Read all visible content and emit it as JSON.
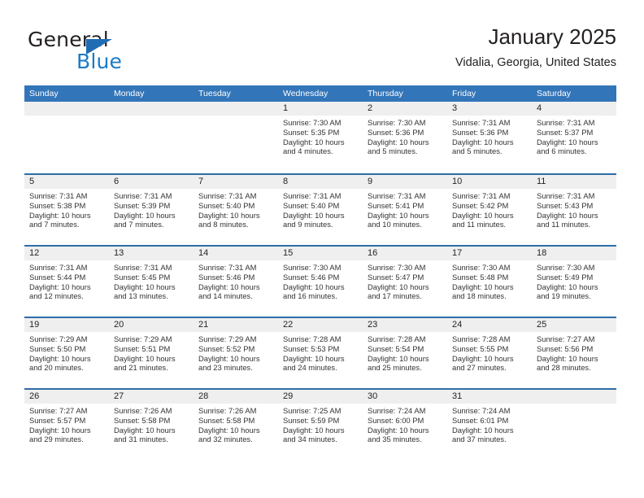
{
  "brand": {
    "name_part1": "General",
    "name_part2": "Blue",
    "accent_color": "#1b7ac4",
    "triangle_color": "#1f6cb4"
  },
  "header": {
    "title": "January 2025",
    "location": "Vidalia, Georgia, United States"
  },
  "theme": {
    "header_row_bg": "#3375b9",
    "week_divider": "#2d6da7",
    "daynum_bg": "#efefef",
    "text_color": "#231f20"
  },
  "weekdays": [
    "Sunday",
    "Monday",
    "Tuesday",
    "Wednesday",
    "Thursday",
    "Friday",
    "Saturday"
  ],
  "weeks": [
    [
      {
        "day": "",
        "sunrise": "",
        "sunset": "",
        "daylight": ""
      },
      {
        "day": "",
        "sunrise": "",
        "sunset": "",
        "daylight": ""
      },
      {
        "day": "",
        "sunrise": "",
        "sunset": "",
        "daylight": ""
      },
      {
        "day": "1",
        "sunrise": "Sunrise: 7:30 AM",
        "sunset": "Sunset: 5:35 PM",
        "daylight": "Daylight: 10 hours and 4 minutes."
      },
      {
        "day": "2",
        "sunrise": "Sunrise: 7:30 AM",
        "sunset": "Sunset: 5:36 PM",
        "daylight": "Daylight: 10 hours and 5 minutes."
      },
      {
        "day": "3",
        "sunrise": "Sunrise: 7:31 AM",
        "sunset": "Sunset: 5:36 PM",
        "daylight": "Daylight: 10 hours and 5 minutes."
      },
      {
        "day": "4",
        "sunrise": "Sunrise: 7:31 AM",
        "sunset": "Sunset: 5:37 PM",
        "daylight": "Daylight: 10 hours and 6 minutes."
      }
    ],
    [
      {
        "day": "5",
        "sunrise": "Sunrise: 7:31 AM",
        "sunset": "Sunset: 5:38 PM",
        "daylight": "Daylight: 10 hours and 7 minutes."
      },
      {
        "day": "6",
        "sunrise": "Sunrise: 7:31 AM",
        "sunset": "Sunset: 5:39 PM",
        "daylight": "Daylight: 10 hours and 7 minutes."
      },
      {
        "day": "7",
        "sunrise": "Sunrise: 7:31 AM",
        "sunset": "Sunset: 5:40 PM",
        "daylight": "Daylight: 10 hours and 8 minutes."
      },
      {
        "day": "8",
        "sunrise": "Sunrise: 7:31 AM",
        "sunset": "Sunset: 5:40 PM",
        "daylight": "Daylight: 10 hours and 9 minutes."
      },
      {
        "day": "9",
        "sunrise": "Sunrise: 7:31 AM",
        "sunset": "Sunset: 5:41 PM",
        "daylight": "Daylight: 10 hours and 10 minutes."
      },
      {
        "day": "10",
        "sunrise": "Sunrise: 7:31 AM",
        "sunset": "Sunset: 5:42 PM",
        "daylight": "Daylight: 10 hours and 11 minutes."
      },
      {
        "day": "11",
        "sunrise": "Sunrise: 7:31 AM",
        "sunset": "Sunset: 5:43 PM",
        "daylight": "Daylight: 10 hours and 11 minutes."
      }
    ],
    [
      {
        "day": "12",
        "sunrise": "Sunrise: 7:31 AM",
        "sunset": "Sunset: 5:44 PM",
        "daylight": "Daylight: 10 hours and 12 minutes."
      },
      {
        "day": "13",
        "sunrise": "Sunrise: 7:31 AM",
        "sunset": "Sunset: 5:45 PM",
        "daylight": "Daylight: 10 hours and 13 minutes."
      },
      {
        "day": "14",
        "sunrise": "Sunrise: 7:31 AM",
        "sunset": "Sunset: 5:46 PM",
        "daylight": "Daylight: 10 hours and 14 minutes."
      },
      {
        "day": "15",
        "sunrise": "Sunrise: 7:30 AM",
        "sunset": "Sunset: 5:46 PM",
        "daylight": "Daylight: 10 hours and 16 minutes."
      },
      {
        "day": "16",
        "sunrise": "Sunrise: 7:30 AM",
        "sunset": "Sunset: 5:47 PM",
        "daylight": "Daylight: 10 hours and 17 minutes."
      },
      {
        "day": "17",
        "sunrise": "Sunrise: 7:30 AM",
        "sunset": "Sunset: 5:48 PM",
        "daylight": "Daylight: 10 hours and 18 minutes."
      },
      {
        "day": "18",
        "sunrise": "Sunrise: 7:30 AM",
        "sunset": "Sunset: 5:49 PM",
        "daylight": "Daylight: 10 hours and 19 minutes."
      }
    ],
    [
      {
        "day": "19",
        "sunrise": "Sunrise: 7:29 AM",
        "sunset": "Sunset: 5:50 PM",
        "daylight": "Daylight: 10 hours and 20 minutes."
      },
      {
        "day": "20",
        "sunrise": "Sunrise: 7:29 AM",
        "sunset": "Sunset: 5:51 PM",
        "daylight": "Daylight: 10 hours and 21 minutes."
      },
      {
        "day": "21",
        "sunrise": "Sunrise: 7:29 AM",
        "sunset": "Sunset: 5:52 PM",
        "daylight": "Daylight: 10 hours and 23 minutes."
      },
      {
        "day": "22",
        "sunrise": "Sunrise: 7:28 AM",
        "sunset": "Sunset: 5:53 PM",
        "daylight": "Daylight: 10 hours and 24 minutes."
      },
      {
        "day": "23",
        "sunrise": "Sunrise: 7:28 AM",
        "sunset": "Sunset: 5:54 PM",
        "daylight": "Daylight: 10 hours and 25 minutes."
      },
      {
        "day": "24",
        "sunrise": "Sunrise: 7:28 AM",
        "sunset": "Sunset: 5:55 PM",
        "daylight": "Daylight: 10 hours and 27 minutes."
      },
      {
        "day": "25",
        "sunrise": "Sunrise: 7:27 AM",
        "sunset": "Sunset: 5:56 PM",
        "daylight": "Daylight: 10 hours and 28 minutes."
      }
    ],
    [
      {
        "day": "26",
        "sunrise": "Sunrise: 7:27 AM",
        "sunset": "Sunset: 5:57 PM",
        "daylight": "Daylight: 10 hours and 29 minutes."
      },
      {
        "day": "27",
        "sunrise": "Sunrise: 7:26 AM",
        "sunset": "Sunset: 5:58 PM",
        "daylight": "Daylight: 10 hours and 31 minutes."
      },
      {
        "day": "28",
        "sunrise": "Sunrise: 7:26 AM",
        "sunset": "Sunset: 5:58 PM",
        "daylight": "Daylight: 10 hours and 32 minutes."
      },
      {
        "day": "29",
        "sunrise": "Sunrise: 7:25 AM",
        "sunset": "Sunset: 5:59 PM",
        "daylight": "Daylight: 10 hours and 34 minutes."
      },
      {
        "day": "30",
        "sunrise": "Sunrise: 7:24 AM",
        "sunset": "Sunset: 6:00 PM",
        "daylight": "Daylight: 10 hours and 35 minutes."
      },
      {
        "day": "31",
        "sunrise": "Sunrise: 7:24 AM",
        "sunset": "Sunset: 6:01 PM",
        "daylight": "Daylight: 10 hours and 37 minutes."
      },
      {
        "day": "",
        "sunrise": "",
        "sunset": "",
        "daylight": ""
      }
    ]
  ]
}
